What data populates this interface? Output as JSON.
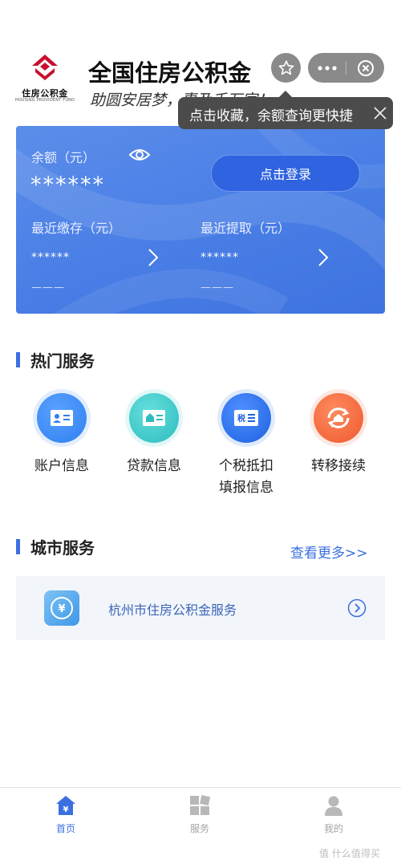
{
  "header": {
    "logo_cn": "住房公积金",
    "logo_en": "HOUSING PROVIDENT FUND",
    "title": "全国住房公积金",
    "slogan": "助圆安居梦，惠及千万家！",
    "tooltip": "点击收藏，余额查询更快捷"
  },
  "card": {
    "balance_label": "余额（元）",
    "balance_value": "******",
    "login_button": "点击登录",
    "recent_deposit_label": "最近缴存（元）",
    "recent_deposit_value": "******",
    "recent_deposit_sub": "———",
    "recent_withdraw_label": "最近提取（元）",
    "recent_withdraw_value": "******",
    "recent_withdraw_sub": "———"
  },
  "hot_services": {
    "title": "热门服务",
    "items": [
      {
        "label": "账户信息",
        "icon": "account-card-icon",
        "color": "#3d86f0"
      },
      {
        "label": "贷款信息",
        "icon": "loan-house-icon",
        "color": "#3dc6c7"
      },
      {
        "label": "个税抵扣\n填报信息",
        "icon": "tax-icon",
        "color": "#2b6fe6"
      },
      {
        "label": "转移接续",
        "icon": "transfer-icon",
        "color": "#f26a3f"
      }
    ]
  },
  "city_services": {
    "title": "城市服务",
    "more": "查看更多>>",
    "item_label": "杭州市住房公积金服务"
  },
  "tabbar": {
    "items": [
      {
        "label": "首页",
        "icon": "home-icon",
        "active": true
      },
      {
        "label": "服务",
        "icon": "services-grid-icon",
        "active": false
      },
      {
        "label": "我的",
        "icon": "user-icon",
        "active": false
      }
    ]
  },
  "watermark": "值 什么值得买",
  "colors": {
    "accent": "#3b6fe0",
    "card_blue": "#4a7fe6",
    "tooltip_bg": "#4b4b4b"
  }
}
